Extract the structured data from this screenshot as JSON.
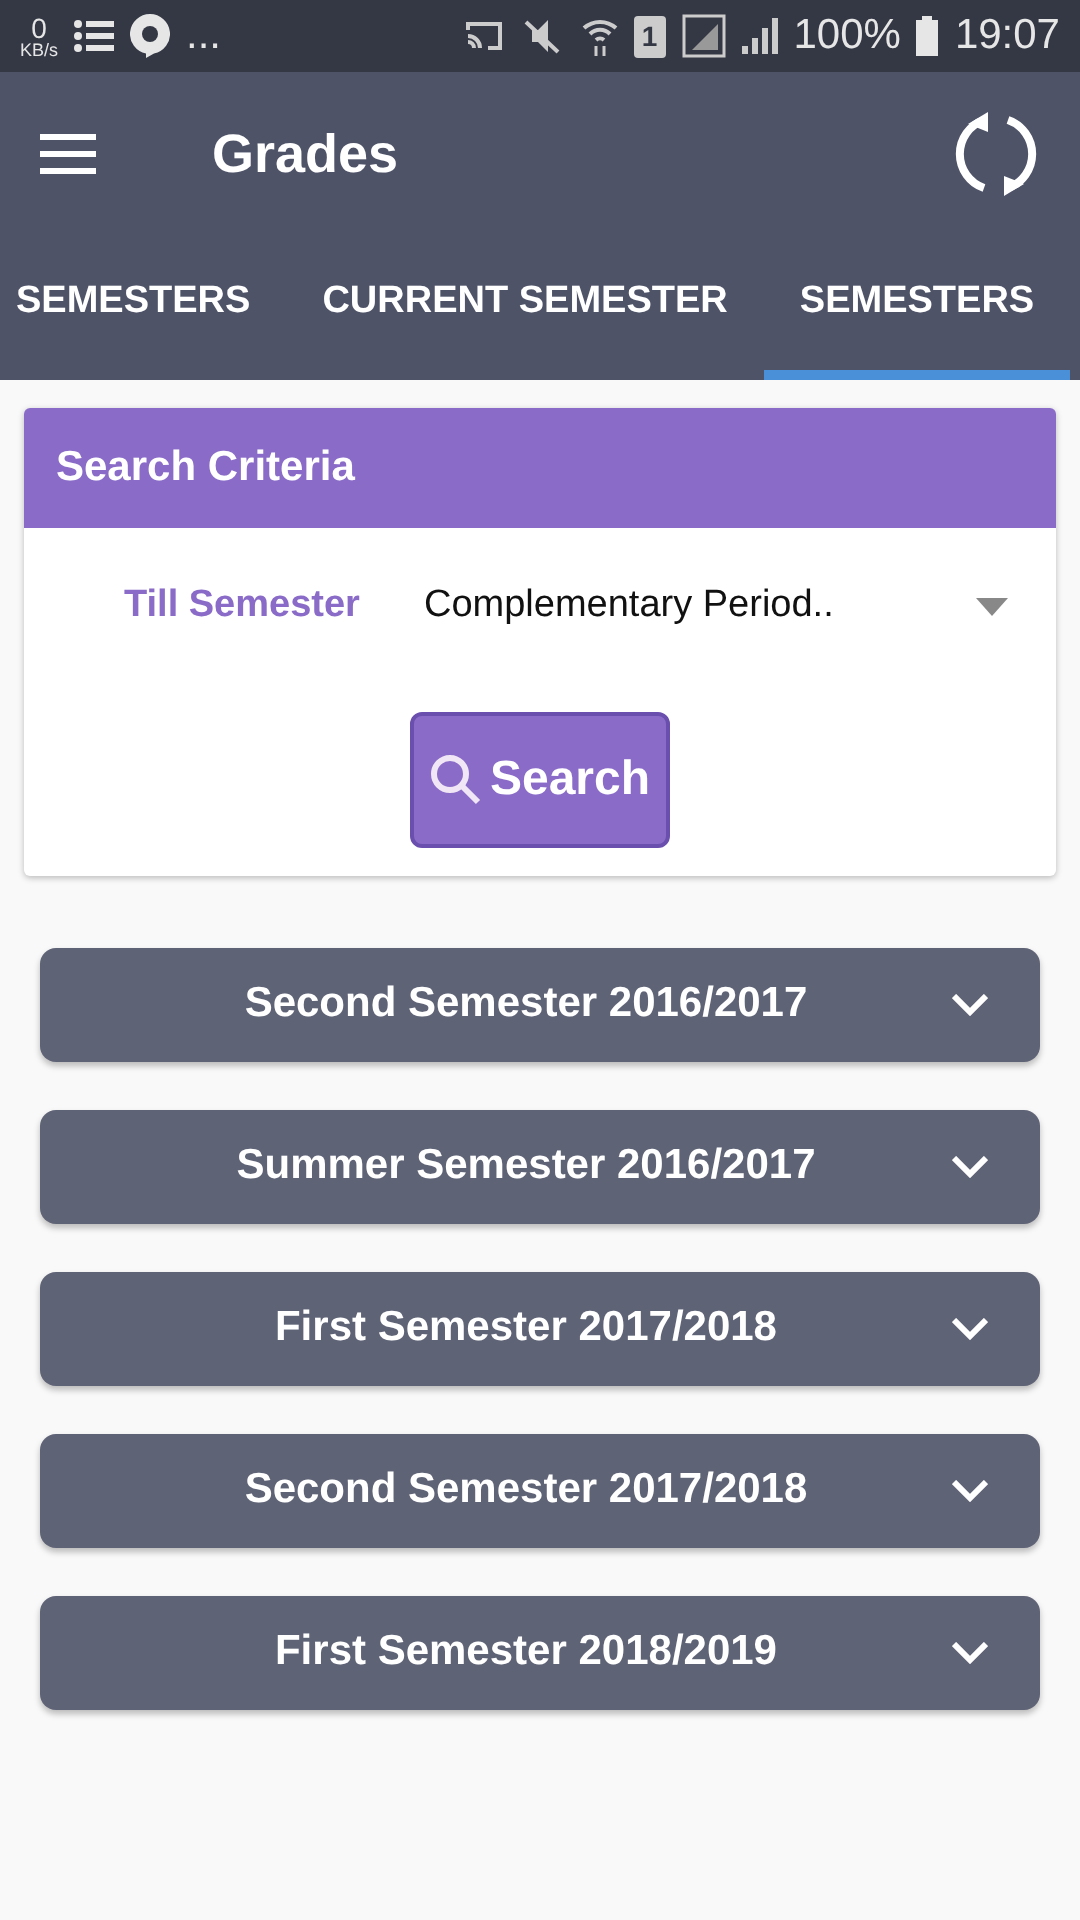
{
  "status_bar": {
    "speed": "0",
    "speed_unit": "KB/s",
    "more": "...",
    "sim": "1",
    "battery": "100%",
    "time": "19:07"
  },
  "app_bar": {
    "title": "Grades"
  },
  "tabs": [
    {
      "label": "SEMESTERS",
      "selected": false
    },
    {
      "label": "CURRENT SEMESTER",
      "selected": false
    },
    {
      "label": "SEMESTERS",
      "selected": true
    }
  ],
  "search_criteria": {
    "title": "Search Criteria",
    "field_label": "Till Semester",
    "value": "Complementary Period..",
    "button": "Search"
  },
  "semesters": [
    {
      "label": "Second Semester 2016/2017",
      "expanded": false
    },
    {
      "label": "Summer Semester 2016/2017",
      "expanded": false
    },
    {
      "label": "First Semester 2017/2018",
      "expanded": false
    },
    {
      "label": "Second Semester 2017/2018",
      "expanded": false
    },
    {
      "label": "First Semester 2018/2019",
      "expanded": false
    }
  ]
}
